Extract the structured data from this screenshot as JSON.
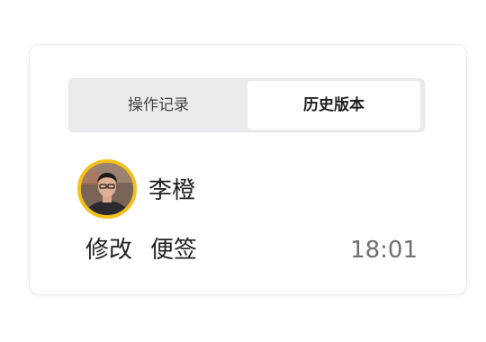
{
  "tabs": {
    "operation_log": "操作记录",
    "history_versions": "历史版本"
  },
  "active_tab": "history_versions",
  "entry": {
    "user_name": "李橙",
    "action_verb": "修改",
    "action_object": "便签",
    "time": "18:01"
  },
  "colors": {
    "avatar_ring": "#f2c11a",
    "tab_bar_bg": "#ebebed",
    "active_tab_bg": "#ffffff",
    "time_text": "#6f6f6f"
  }
}
